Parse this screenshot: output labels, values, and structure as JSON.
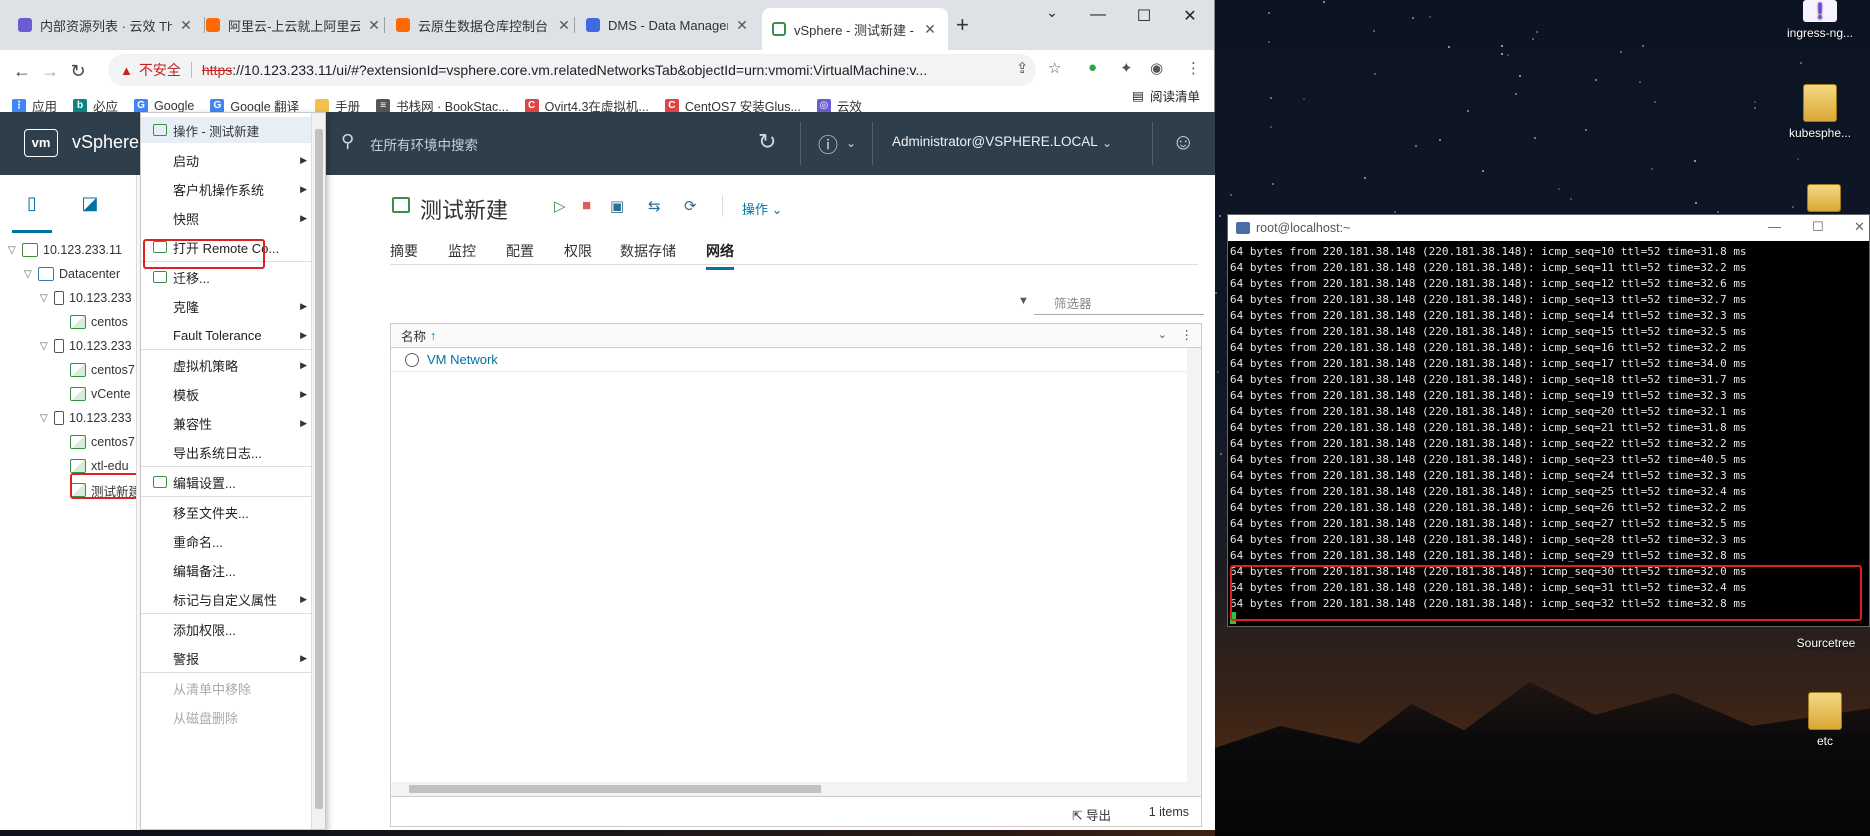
{
  "browser": {
    "tabs": [
      {
        "title": "内部资源列表 · 云效 Th",
        "color": "#6b5cd6"
      },
      {
        "title": "阿里云-上云就上阿里云",
        "color": "#ff6a00"
      },
      {
        "title": "云原生数据仓库控制台",
        "color": "#ff6a00"
      },
      {
        "title": "DMS - Data Managem",
        "color": "#4169e1"
      },
      {
        "title": "vSphere - 测试新建 -  ",
        "color": "#3b8f4b"
      }
    ],
    "new_tab": "+",
    "url_warning": "不安全",
    "url_scheme": "https",
    "url_rest": "://10.123.233.11/ui/#?extensionId=vsphere.core.vm.relatedNetworksTab&objectId=urn:vmomi:VirtualMachine:v...",
    "bookmarks": [
      {
        "label": "应用",
        "color": "#4285f4",
        "glyph": "⋮"
      },
      {
        "label": "必应",
        "color": "#0c8484",
        "glyph": "b"
      },
      {
        "label": "Google",
        "color": "#4285f4",
        "glyph": "G"
      },
      {
        "label": "Google 翻译",
        "color": "#4285f4",
        "glyph": "G"
      },
      {
        "label": "手册",
        "color": "#f2c14e",
        "glyph": ""
      },
      {
        "label": "书栈网 · BookStac...",
        "color": "#555",
        "glyph": "≡"
      },
      {
        "label": "Ovirt4.3在虚拟机...",
        "color": "#d44",
        "glyph": "C"
      },
      {
        "label": "CentOS7 安装Glus...",
        "color": "#d44",
        "glyph": "C"
      },
      {
        "label": "云效",
        "color": "#6b5cd6",
        "glyph": "◎"
      }
    ],
    "reading_list": "阅读清单"
  },
  "vsphere": {
    "logo": "vm",
    "product": "vSphere",
    "search_placeholder": "在所有环境中搜索",
    "user": "Administrator@VSPHERE.LOCAL",
    "tree": [
      {
        "label": "10.123.233.11",
        "level": 0,
        "kind": "vc",
        "twisty": "▽"
      },
      {
        "label": "Datacenter",
        "level": 1,
        "kind": "dc",
        "twisty": "▽"
      },
      {
        "label": "10.123.233",
        "level": 2,
        "kind": "host",
        "twisty": "▽"
      },
      {
        "label": "centos",
        "level": 3,
        "kind": "vm",
        "twisty": ""
      },
      {
        "label": "10.123.233",
        "level": 2,
        "kind": "host",
        "twisty": "▽"
      },
      {
        "label": "centos7",
        "level": 3,
        "kind": "vm",
        "twisty": ""
      },
      {
        "label": "vCente",
        "level": 3,
        "kind": "vm",
        "twisty": ""
      },
      {
        "label": "10.123.233",
        "level": 2,
        "kind": "host",
        "twisty": "▽"
      },
      {
        "label": "centos7",
        "level": 3,
        "kind": "vm",
        "twisty": ""
      },
      {
        "label": "xtl-edu",
        "level": 3,
        "kind": "vm",
        "twisty": ""
      },
      {
        "label": "测试新建",
        "level": 3,
        "kind": "vm",
        "twisty": ""
      }
    ],
    "context_menu": {
      "header": "操作 - 测试新建",
      "items": [
        {
          "label": "启动",
          "submenu": true
        },
        {
          "label": "客户机操作系统",
          "submenu": true
        },
        {
          "label": "快照",
          "submenu": true
        },
        {
          "label": "打开 Remote Co...",
          "submenu": false,
          "icon": true
        },
        {
          "label": "迁移...",
          "submenu": false,
          "icon": true
        },
        {
          "label": "克隆",
          "submenu": true
        },
        {
          "label": "Fault Tolerance",
          "submenu": true
        },
        {
          "label": "虚拟机策略",
          "submenu": true
        },
        {
          "label": "模板",
          "submenu": true
        },
        {
          "label": "兼容性",
          "submenu": true
        },
        {
          "label": "导出系统日志...",
          "submenu": false
        },
        {
          "label": "编辑设置...",
          "submenu": false,
          "icon": true
        },
        {
          "label": "移至文件夹...",
          "submenu": false
        },
        {
          "label": "重命名...",
          "submenu": false
        },
        {
          "label": "编辑备注...",
          "submenu": false
        },
        {
          "label": "标记与自定义属性",
          "submenu": true
        },
        {
          "label": "添加权限...",
          "submenu": false
        },
        {
          "label": "警报",
          "submenu": true
        },
        {
          "label": "从清单中移除",
          "submenu": false,
          "disabled": true
        },
        {
          "label": "从磁盘删除",
          "submenu": false,
          "disabled": true
        }
      ]
    },
    "vm_title": "测试新建",
    "actions_label": "操作",
    "tabs": [
      "摘要",
      "监控",
      "配置",
      "权限",
      "数据存储",
      "网络"
    ],
    "active_tab": "网络",
    "filter_placeholder": "筛选器",
    "grid": {
      "column": "名称",
      "sort_icon": "↑",
      "rows": [
        "VM Network"
      ]
    },
    "export_label": "导出",
    "item_count": "1 items"
  },
  "terminal": {
    "title": "root@localhost:~",
    "lines": [
      "64 bytes from 220.181.38.148 (220.181.38.148): icmp_seq=10 ttl=52 time=31.8 ms",
      "64 bytes from 220.181.38.148 (220.181.38.148): icmp_seq=11 ttl=52 time=32.2 ms",
      "64 bytes from 220.181.38.148 (220.181.38.148): icmp_seq=12 ttl=52 time=32.6 ms",
      "64 bytes from 220.181.38.148 (220.181.38.148): icmp_seq=13 ttl=52 time=32.7 ms",
      "64 bytes from 220.181.38.148 (220.181.38.148): icmp_seq=14 ttl=52 time=32.3 ms",
      "64 bytes from 220.181.38.148 (220.181.38.148): icmp_seq=15 ttl=52 time=32.5 ms",
      "64 bytes from 220.181.38.148 (220.181.38.148): icmp_seq=16 ttl=52 time=32.2 ms",
      "64 bytes from 220.181.38.148 (220.181.38.148): icmp_seq=17 ttl=52 time=34.0 ms",
      "64 bytes from 220.181.38.148 (220.181.38.148): icmp_seq=18 ttl=52 time=31.7 ms",
      "64 bytes from 220.181.38.148 (220.181.38.148): icmp_seq=19 ttl=52 time=32.3 ms",
      "64 bytes from 220.181.38.148 (220.181.38.148): icmp_seq=20 ttl=52 time=32.1 ms",
      "64 bytes from 220.181.38.148 (220.181.38.148): icmp_seq=21 ttl=52 time=31.8 ms",
      "64 bytes from 220.181.38.148 (220.181.38.148): icmp_seq=22 ttl=52 time=32.2 ms",
      "64 bytes from 220.181.38.148 (220.181.38.148): icmp_seq=23 ttl=52 time=40.5 ms",
      "64 bytes from 220.181.38.148 (220.181.38.148): icmp_seq=24 ttl=52 time=32.3 ms",
      "64 bytes from 220.181.38.148 (220.181.38.148): icmp_seq=25 ttl=52 time=32.4 ms",
      "64 bytes from 220.181.38.148 (220.181.38.148): icmp_seq=26 ttl=52 time=32.2 ms",
      "64 bytes from 220.181.38.148 (220.181.38.148): icmp_seq=27 ttl=52 time=32.5 ms",
      "64 bytes from 220.181.38.148 (220.181.38.148): icmp_seq=28 ttl=52 time=32.3 ms",
      "64 bytes from 220.181.38.148 (220.181.38.148): icmp_seq=29 ttl=52 time=32.8 ms",
      "64 bytes from 220.181.38.148 (220.181.38.148): icmp_seq=30 ttl=52 time=32.0 ms",
      "64 bytes from 220.181.38.148 (220.181.38.148): icmp_seq=31 ttl=52 time=32.4 ms",
      "64 bytes from 220.181.38.148 (220.181.38.148): icmp_seq=32 ttl=52 time=32.8 ms"
    ]
  },
  "desktop": {
    "icons": [
      {
        "label": "ingress-ng...",
        "style": "purple"
      },
      {
        "label": "kubesphe...",
        "style": "folder"
      },
      {
        "label": "Sourcetree",
        "style": "none"
      },
      {
        "label": "etc",
        "style": "folder"
      }
    ]
  },
  "colors": {
    "vsphere_header": "#2f3e4b",
    "link_blue": "#0072a3",
    "highlight_red": "#e02020"
  }
}
